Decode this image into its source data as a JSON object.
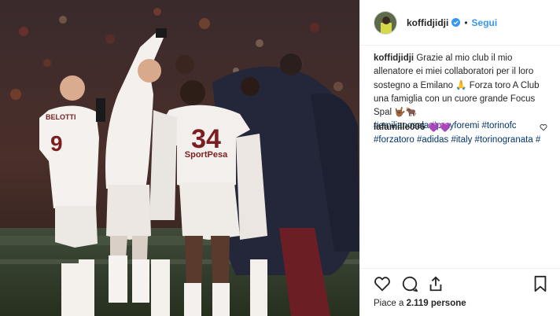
{
  "post": {
    "username": "koffidjidji",
    "follow_label": "Segui",
    "separator": "•",
    "caption": {
      "user": "koffidjidji",
      "text": "Grazie al mio club il mio allenatore ei miei collaboratori per il loro sostegno a Emilano 🙏 Forza toro A Club una famiglia con un cuore grande Focus Spal 🤟🏾🐂",
      "hashtags": [
        "#emilianosala",
        "#prayforemi",
        "#torinofc",
        "#forzatoro",
        "#adidas",
        "#italy",
        "#torinogranata",
        "#"
      ]
    },
    "comment": {
      "user": "lafamille006",
      "emoji": "💜💜"
    },
    "likes": {
      "prefix": "Piace a ",
      "count": "2.119 persone"
    },
    "photo": {
      "jersey_back_text": "34",
      "jersey_sponsor": "SportPesa",
      "jersey_left_number": "9",
      "jersey_left_name": "BELOTTI"
    },
    "colors": {
      "follow_blue": "#3897f0",
      "hashtag_blue": "#003569",
      "verified_blue": "#3897f0",
      "border": "#efefef"
    },
    "icons": [
      "heart-icon",
      "comment-icon",
      "share-icon",
      "bookmark-icon",
      "verified-icon"
    ]
  }
}
